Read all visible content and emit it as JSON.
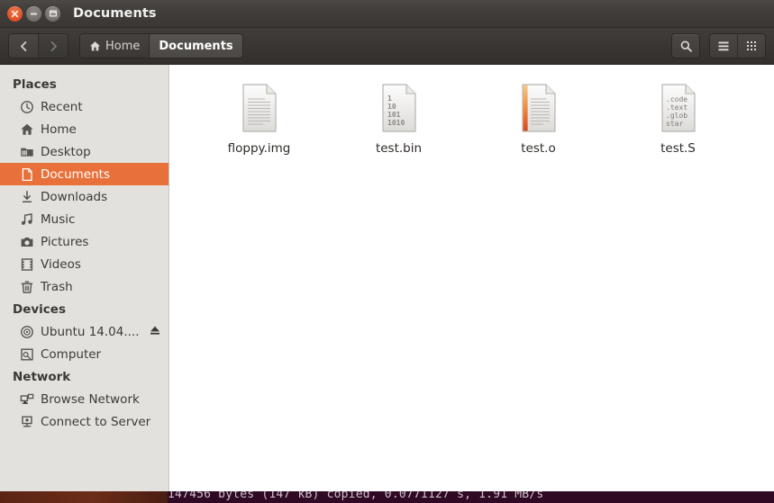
{
  "window": {
    "title": "Documents",
    "controls": [
      {
        "name": "close",
        "glyph": "close-icon"
      },
      {
        "name": "minimize",
        "glyph": "minimize-icon"
      },
      {
        "name": "maximize",
        "glyph": "maximize-icon"
      }
    ]
  },
  "toolbar": {
    "back_label": "Back",
    "forward_label": "Forward",
    "breadcrumbs": [
      {
        "label": "Home",
        "icon": "home-icon",
        "active": false
      },
      {
        "label": "Documents",
        "icon": "",
        "active": true
      }
    ],
    "search_label": "Search",
    "list_view_label": "List view",
    "grid_view_label": "Icon view"
  },
  "sidebar": {
    "sections": [
      {
        "title": "Places",
        "items": [
          {
            "label": "Recent",
            "icon": "clock-icon",
            "selected": false
          },
          {
            "label": "Home",
            "icon": "home-icon",
            "selected": false
          },
          {
            "label": "Desktop",
            "icon": "desktop-folder-icon",
            "selected": false
          },
          {
            "label": "Documents",
            "icon": "document-icon",
            "selected": true
          },
          {
            "label": "Downloads",
            "icon": "download-icon",
            "selected": false
          },
          {
            "label": "Music",
            "icon": "music-note-icon",
            "selected": false
          },
          {
            "label": "Pictures",
            "icon": "camera-icon",
            "selected": false
          },
          {
            "label": "Videos",
            "icon": "film-icon",
            "selected": false
          },
          {
            "label": "Trash",
            "icon": "trash-icon",
            "selected": false
          }
        ]
      },
      {
        "title": "Devices",
        "items": [
          {
            "label": "Ubuntu 14.04....",
            "icon": "disc-icon",
            "selected": false,
            "eject": true
          },
          {
            "label": "Computer",
            "icon": "computer-icon",
            "selected": false
          }
        ]
      },
      {
        "title": "Network",
        "items": [
          {
            "label": "Browse Network",
            "icon": "network-icon",
            "selected": false
          },
          {
            "label": "Connect to Server",
            "icon": "server-icon",
            "selected": false
          }
        ]
      }
    ]
  },
  "files": [
    {
      "name": "floppy.img",
      "icon": "text-document-icon",
      "lines": []
    },
    {
      "name": "test.bin",
      "icon": "binary-file-icon",
      "lines": [
        "1",
        "10",
        "101",
        "1010"
      ]
    },
    {
      "name": "test.o",
      "icon": "object-file-icon",
      "lines": []
    },
    {
      "name": "test.S",
      "icon": "assembly-source-icon",
      "lines": [
        ".code",
        ".text",
        ".glob",
        "star"
      ]
    }
  ],
  "terminal": {
    "output_line": "147456 bytes (147 kB) copied, 0.0771127 s, 1.91 MB/s"
  },
  "colors": {
    "accent": "#e8703a",
    "titlebar": "#403d3a",
    "sidebar": "#e3e1de",
    "terminal_bg": "#300a24"
  }
}
